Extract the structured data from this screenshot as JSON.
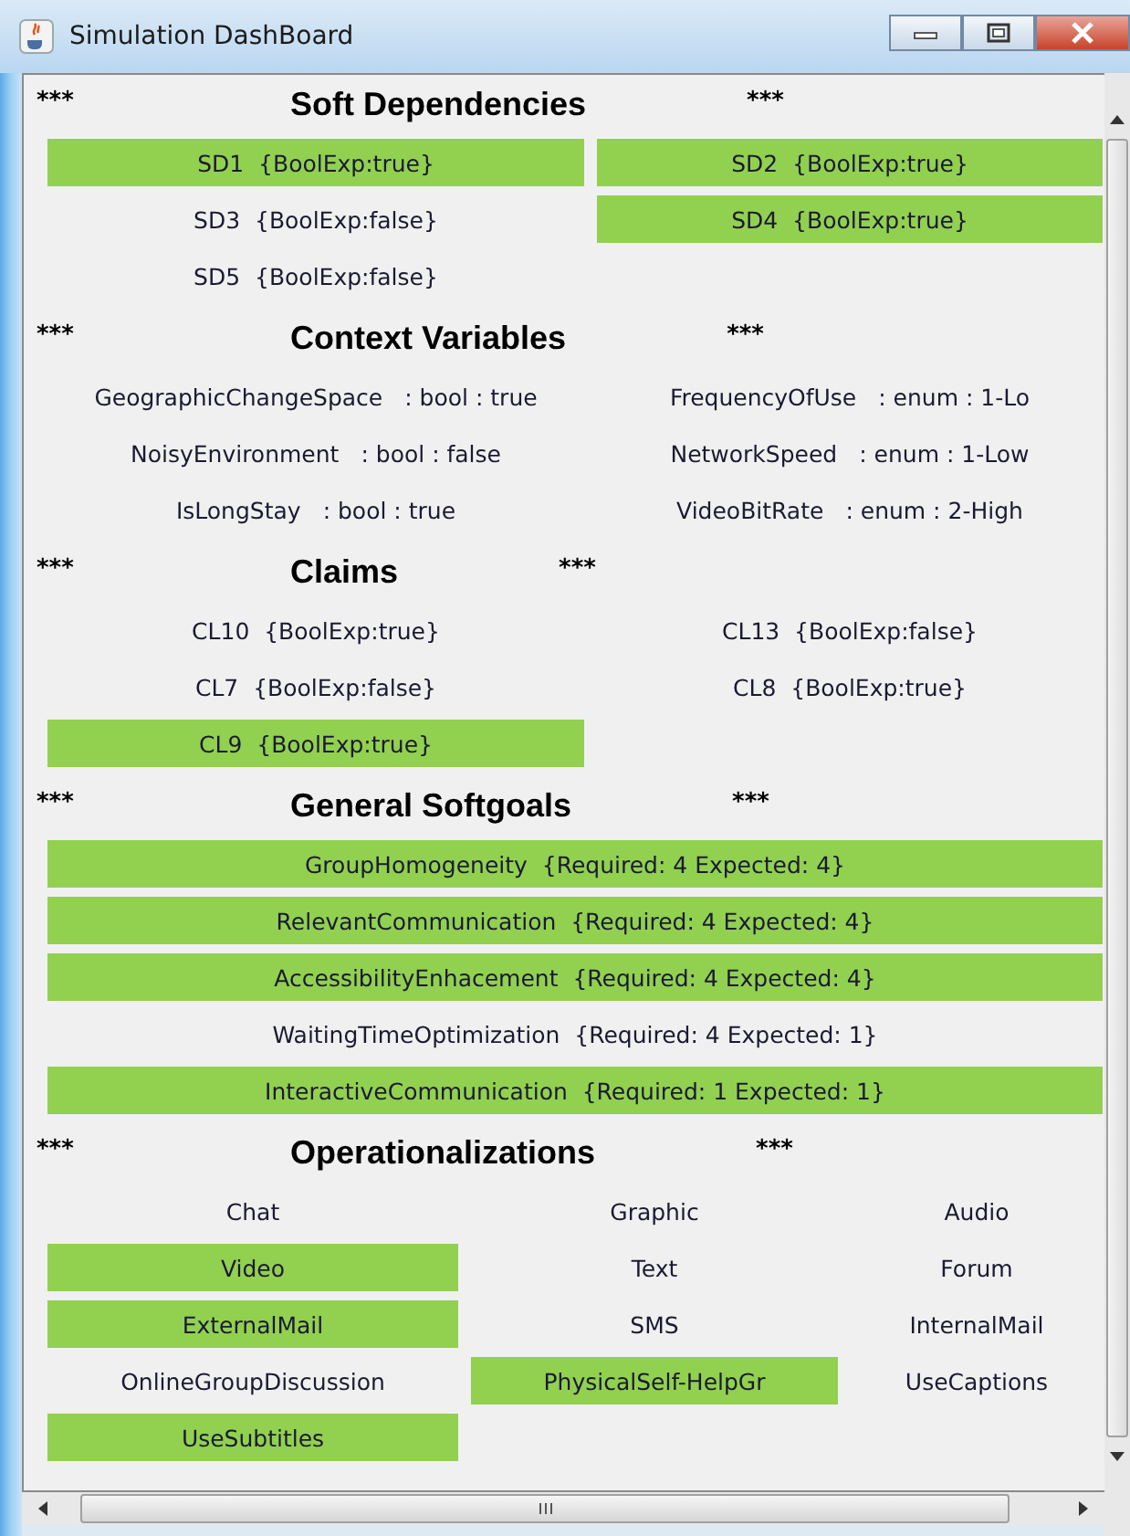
{
  "window": {
    "title": "Simulation DashBoard"
  },
  "sections": [
    {
      "kind": "grid2",
      "title": "Soft Dependencies",
      "marks": [
        "***",
        "***"
      ],
      "items": [
        {
          "label": "SD1  {BoolExp:true}",
          "highlighted": true
        },
        {
          "label": "SD2  {BoolExp:true}",
          "highlighted": true
        },
        {
          "label": "SD3  {BoolExp:false}",
          "highlighted": false
        },
        {
          "label": "SD4  {BoolExp:true}",
          "highlighted": true
        },
        {
          "label": "SD5  {BoolExp:false}",
          "highlighted": false
        }
      ]
    },
    {
      "kind": "vars",
      "title": "Context Variables",
      "marks": [
        "***",
        "***"
      ],
      "items": [
        {
          "name": "GeographicChangeSpace",
          "detail": ": bool : true"
        },
        {
          "name": "FrequencyOfUse",
          "detail": ": enum : 1-Lo"
        },
        {
          "name": "NoisyEnvironment",
          "detail": ": bool : false"
        },
        {
          "name": "NetworkSpeed",
          "detail": ": enum : 1-Low"
        },
        {
          "name": "IsLongStay",
          "detail": ": bool : true"
        },
        {
          "name": "VideoBitRate",
          "detail": ": enum : 2-High"
        }
      ]
    },
    {
      "kind": "grid2",
      "title": "Claims",
      "marks": [
        "***",
        "***"
      ],
      "items": [
        {
          "label": "CL10  {BoolExp:true}",
          "highlighted": false
        },
        {
          "label": "CL13  {BoolExp:false}",
          "highlighted": false
        },
        {
          "label": "CL7  {BoolExp:false}",
          "highlighted": false
        },
        {
          "label": "CL8  {BoolExp:true}",
          "highlighted": false
        },
        {
          "label": "CL9  {BoolExp:true}",
          "highlighted": true
        }
      ]
    },
    {
      "kind": "grid1",
      "title": "General Softgoals",
      "marks": [
        "***",
        "***"
      ],
      "items": [
        {
          "label": "GroupHomogeneity  {Required: 4 Expected: 4}",
          "highlighted": true
        },
        {
          "label": "RelevantCommunication  {Required: 4 Expected: 4}",
          "highlighted": true
        },
        {
          "label": "AccessibilityEnhacement  {Required: 4 Expected: 4}",
          "highlighted": true
        },
        {
          "label": "WaitingTimeOptimization  {Required: 4 Expected: 1}",
          "highlighted": false
        },
        {
          "label": "InteractiveCommunication  {Required: 1 Expected: 1}",
          "highlighted": true
        }
      ]
    },
    {
      "kind": "grid3",
      "title": "Operationalizations",
      "marks": [
        "***",
        "***"
      ],
      "items": [
        {
          "label": "Chat",
          "highlighted": false
        },
        {
          "label": "Graphic",
          "highlighted": false
        },
        {
          "label": "Audio",
          "highlighted": false
        },
        {
          "label": "Video",
          "highlighted": true
        },
        {
          "label": "Text",
          "highlighted": false
        },
        {
          "label": "Forum",
          "highlighted": false
        },
        {
          "label": "ExternalMail",
          "highlighted": true
        },
        {
          "label": "SMS",
          "highlighted": false
        },
        {
          "label": "InternalMail",
          "highlighted": false
        },
        {
          "label": "OnlineGroupDiscussion",
          "highlighted": false
        },
        {
          "label": "PhysicalSelf-HelpGr",
          "highlighted": true
        },
        {
          "label": "UseCaptions",
          "highlighted": false
        },
        {
          "label": "UseSubtitles",
          "highlighted": true
        }
      ]
    }
  ]
}
